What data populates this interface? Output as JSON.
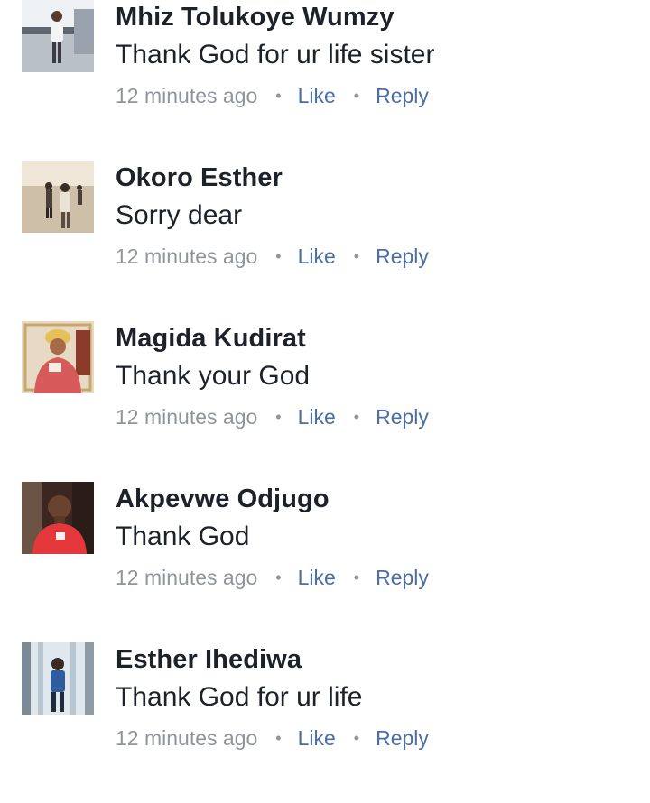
{
  "comments": [
    {
      "name": "Mhiz Tolukoye Wumzy",
      "text": "Thank God for ur life sister",
      "time": "12 minutes ago",
      "like": "Like",
      "reply": "Reply",
      "avatar_icon": "profile-photo-woman-standing"
    },
    {
      "name": "Okoro Esther",
      "text": "Sorry dear",
      "time": "12 minutes ago",
      "like": "Like",
      "reply": "Reply",
      "avatar_icon": "profile-photo-people-walking"
    },
    {
      "name": "Magida Kudirat",
      "text": "Thank your God",
      "time": "12 minutes ago",
      "like": "Like",
      "reply": "Reply",
      "avatar_icon": "profile-photo-woman-headwrap"
    },
    {
      "name": "Akpevwe Odjugo",
      "text": "Thank God",
      "time": "12 minutes ago",
      "like": "Like",
      "reply": "Reply",
      "avatar_icon": "profile-photo-man-red-shirt"
    },
    {
      "name": "Esther Ihediwa",
      "text": "Thank God for ur life",
      "time": "12 minutes ago",
      "like": "Like",
      "reply": "Reply",
      "avatar_icon": "profile-photo-mirror-selfie"
    }
  ],
  "separator": "•",
  "colors": {
    "name": "#1d2129",
    "meta": "#90949c",
    "action": "#4b6ea3"
  }
}
